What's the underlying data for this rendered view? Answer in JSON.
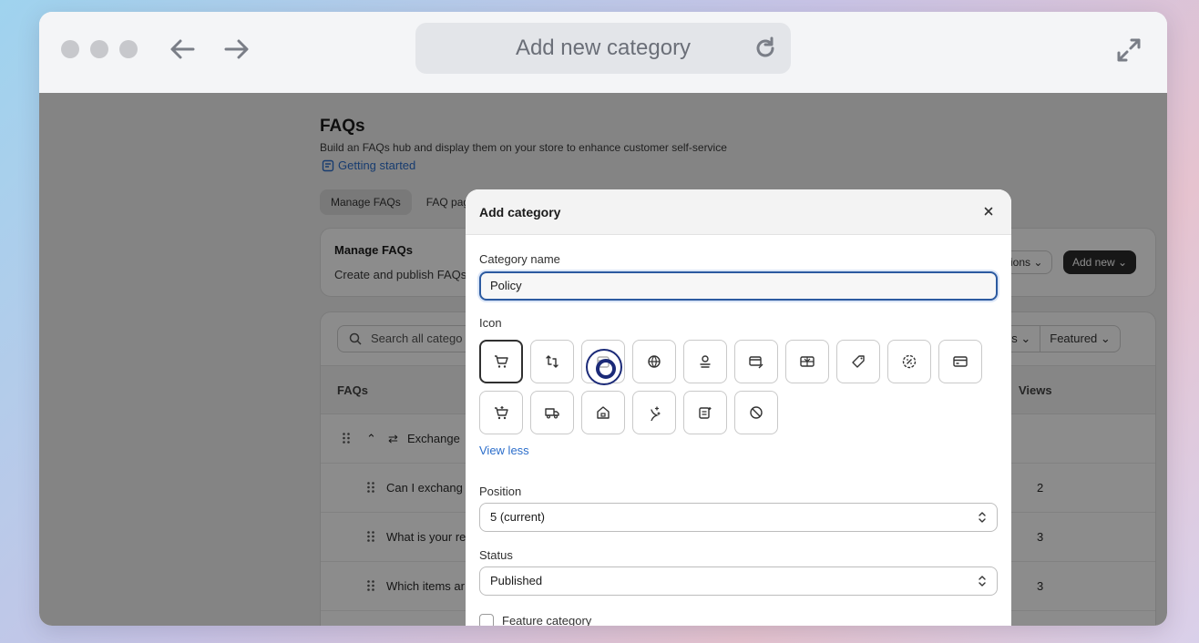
{
  "window": {
    "address_bar": "Add new category"
  },
  "page": {
    "title": "FAQs",
    "subtitle": "Build an FAQs hub and display them on your store to enhance customer self-service",
    "getting_started": "Getting started",
    "tabs": [
      {
        "label": "Manage FAQs",
        "active": true
      },
      {
        "label": "FAQ pag",
        "active": false
      }
    ],
    "manage_card": {
      "title": "Manage FAQs",
      "subtitle": "Create and publish FAQs",
      "options_label": "ions",
      "add_new_label": "Add new"
    },
    "list_card": {
      "search_placeholder": "Search all catego",
      "filters": [
        "us",
        "Featured"
      ],
      "columns": {
        "faqs": "FAQs",
        "views": "Views"
      },
      "category_row": {
        "label": "Exchange"
      },
      "rows": [
        {
          "text": "Can I exchang",
          "views": "2"
        },
        {
          "text": "What is your re",
          "views": "3"
        },
        {
          "text": "Which items ar",
          "views": "3"
        }
      ]
    }
  },
  "modal": {
    "title": "Add category",
    "category_name_label": "Category name",
    "category_name_value": "Policy",
    "icon_label": "Icon",
    "icons": [
      "cart-icon",
      "exchange-icon",
      "calendar-icon",
      "globe-icon",
      "user-coin-icon",
      "card-percent-icon",
      "gift-card-icon",
      "tag-icon",
      "discount-badge-icon",
      "credit-card-icon",
      "cart-sparkle-icon",
      "delivery-truck-icon",
      "store-lock-icon",
      "sparkle-icon",
      "receipt-icon",
      "prohibited-icon"
    ],
    "selected_icon": 0,
    "view_less": "View less",
    "position_label": "Position",
    "position_value": "5 (current)",
    "status_label": "Status",
    "status_value": "Published",
    "feature_label": "Feature category"
  },
  "colors": {
    "accent": "#2c5aa0",
    "link": "#2c6ecb",
    "cursor": "#1b2a78"
  }
}
